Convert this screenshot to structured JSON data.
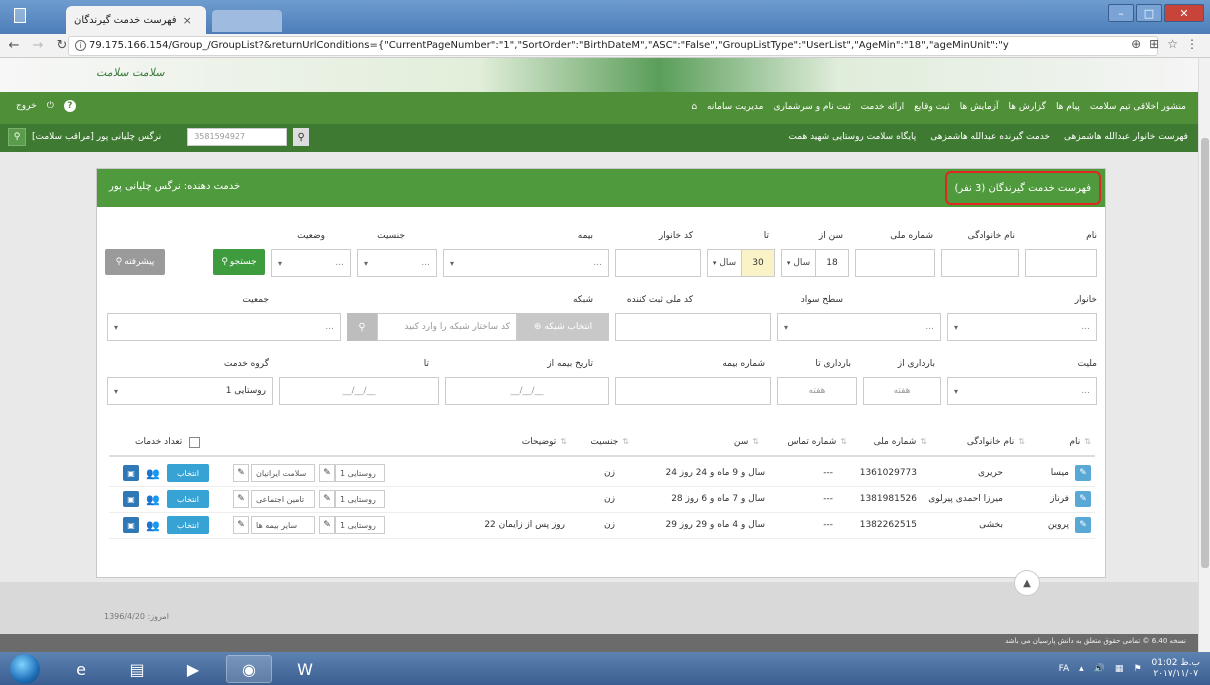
{
  "browser": {
    "tab_title": "فهرست خدمت گیرندگان",
    "tab_close": "×",
    "url": "79.175.166.154/Group_/GroupList?&returnUrlConditions={\"CurrentPageNumber\":\"1\",\"SortOrder\":\"BirthDateM\",\"ASC\":\"False\",\"GroupListType\":\"UserList\",\"AgeMin\":\"18\",\"ageMinUnit\":\"y"
  },
  "header": {
    "logo_text": "سلامت سلامت",
    "menu": [
      "مدیریت سامانه",
      "ثبت نام و سرشماری",
      "ارائه خدمت",
      "ثبت وقایع",
      "آزمایش ها",
      "گزارش ها",
      "پیام ها",
      "منشور اخلاقی تیم سلامت"
    ],
    "help": "?",
    "exit": "خروج",
    "breadcrumbs": [
      "پایگاه سلامت روستایی شهید همت",
      "خدمت گیرنده عبدالله هاشمزهی",
      "فهرست خانوار عبدالله هاشمزهی"
    ],
    "national_id_value": "3581594927",
    "user_name": "نرگس چلیانی پور [مراقب سلامت]"
  },
  "panel": {
    "title": "فهرست خدمت گیرندگان (3 نفر)",
    "provider": "خدمت دهنده: نرگس چلیانی پور"
  },
  "filters": {
    "row1_labels": {
      "first_name": "نام",
      "last_name": "نام خانوادگی",
      "national_id": "شماره ملی",
      "age_from": "سن از",
      "age_to": "تا",
      "household_code": "کد خانوار",
      "insurance": "بیمه",
      "gender": "جنسیت",
      "status": "وضعیت"
    },
    "age_from_value": "18",
    "age_from_unit": "سال",
    "age_to_value": "30",
    "age_to_unit": "سال",
    "search_btn": "جستجو",
    "advanced_btn": "پیشرفته",
    "row2_labels": {
      "household": "خانوار",
      "education": "سطح سواد",
      "registrar_id": "کد ملی ثبت کننده",
      "network": "شبکه",
      "population": "جمعیت"
    },
    "network_btn": "انتخاب شبکه",
    "network_placeholder": "کد ساختار شبکه را وارد کنید",
    "row3_labels": {
      "nationality": "ملیت",
      "pregnancy_from": "بارداری از",
      "pregnancy_to": "بارداری تا",
      "insurance_no": "شماره بیمه",
      "insurance_date_from": "تاریخ بیمه از",
      "to": "تا",
      "service_group": "گروه خدمت"
    },
    "week_placeholder": "هفته",
    "date_placeholder": "__/__/__",
    "service_group_value": "روستایی 1",
    "select_placeholder": "..."
  },
  "table": {
    "headers": [
      "نام",
      "نام خانوادگی",
      "شماره ملی",
      "شماره تماس",
      "سن",
      "جنسیت",
      "توضیحات",
      "تعداد خدمات"
    ],
    "select_label": "انتخاب",
    "rows": [
      {
        "first": "میسا",
        "last": "حریری",
        "nid": "1361029773",
        "phone": "---",
        "age": "24 سال و 9 ماه و 24 روز",
        "gender": "زن",
        "notes": "",
        "group": "روستایی 1",
        "insurance": "سلامت ایرانیان"
      },
      {
        "first": "فرناز",
        "last": "میرزا احمدی پیرلوی",
        "nid": "1381981526",
        "phone": "---",
        "age": "28 سال و 7 ماه و 6 روز",
        "gender": "زن",
        "notes": "",
        "group": "روستایی 1",
        "insurance": "تامین اجتماعی"
      },
      {
        "first": "پروین",
        "last": "بخشی",
        "nid": "1382262515",
        "phone": "---",
        "age": "29 سال و 4 ماه و 29 روز",
        "gender": "زن",
        "notes": "22 روز پس از زایمان",
        "group": "روستایی 1",
        "insurance": "سایر بیمه ها"
      }
    ]
  },
  "footer": {
    "date": "امروز: 1396/4/20",
    "copyright": "نسخه 6.40 © تمامی حقوق متعلق به دانش پارسیان می باشد",
    "scroll_up": "▲"
  },
  "taskbar": {
    "lang": "FA",
    "time": "01:02 ب.ظ",
    "date": "۲۰۱۷/۱۱/۰۷"
  },
  "colors": {
    "primary_green": "#4f9a3d",
    "menu_green": "#4f8f38",
    "highlight_red": "#e0281f",
    "select_blue": "#37a2d4"
  }
}
